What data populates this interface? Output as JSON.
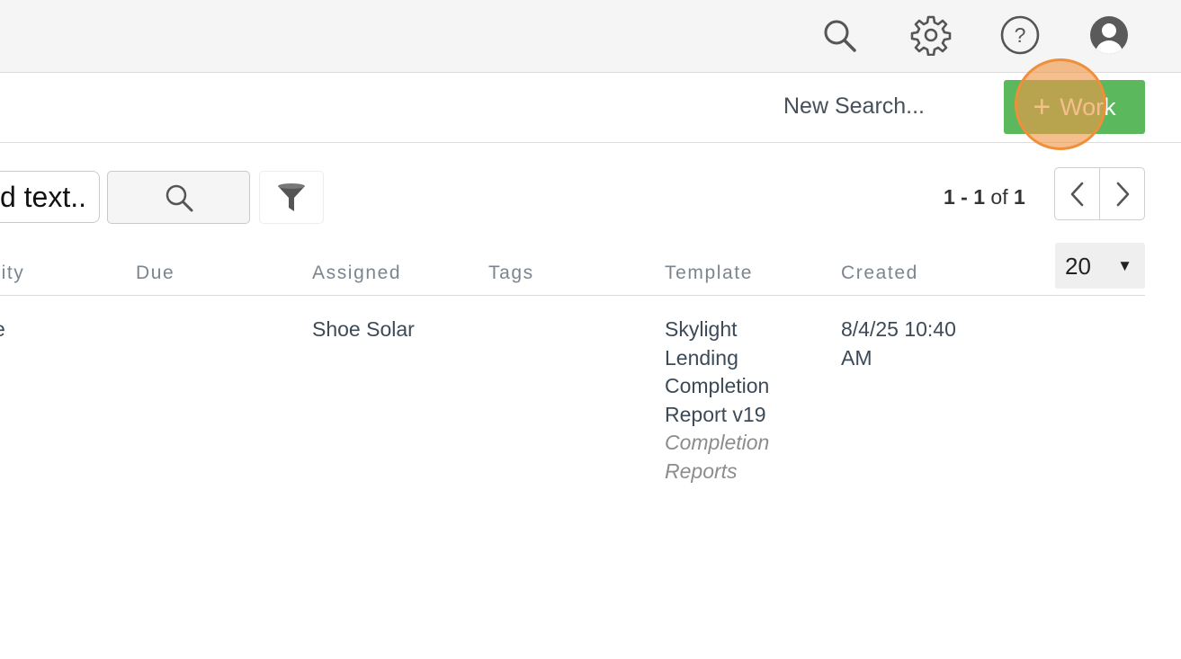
{
  "topbar": {
    "icons": [
      "search-icon",
      "gear-icon",
      "help-icon",
      "user-avatar-icon"
    ]
  },
  "subbar": {
    "new_search_label": "New Search...",
    "add_work_plus": "+",
    "add_work_label": "Work",
    "accent_color": "#5cb85c",
    "highlight_color": "#ef8f3a"
  },
  "search": {
    "input_value": "d text.."
  },
  "pagination": {
    "range_start": "1",
    "range_sep": " - ",
    "range_end": "1",
    "of_label": " of ",
    "total": "1",
    "per_page": "20"
  },
  "table": {
    "columns": [
      "rity",
      "Due",
      "Assigned",
      "Tags",
      "Template",
      "Created"
    ],
    "rows": [
      {
        "priority": "e",
        "due": "",
        "assigned": "Shoe Solar",
        "tags": "",
        "template": "Skylight Lending Completion Report v19",
        "template_category": "Completion Reports",
        "created": "8/4/25 10:40 AM"
      }
    ]
  }
}
